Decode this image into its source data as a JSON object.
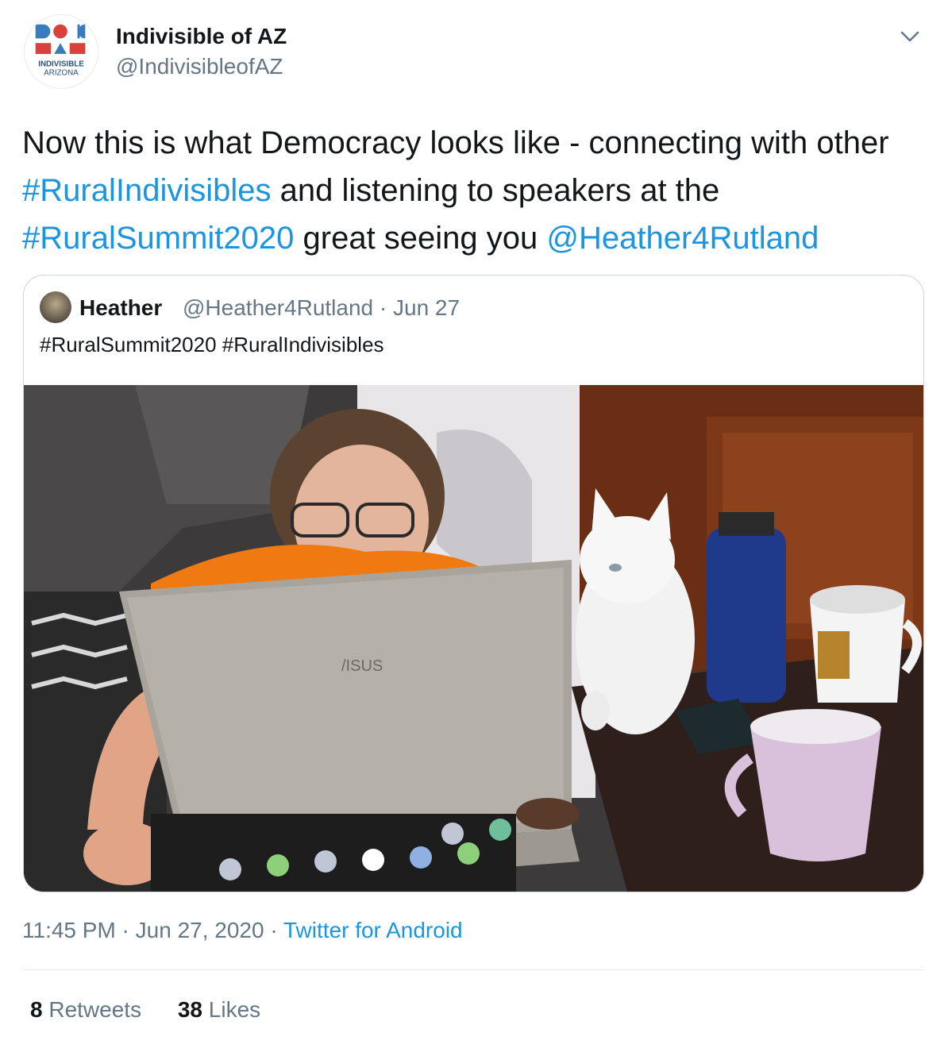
{
  "author": {
    "name": "Indivisible of AZ",
    "handle": "@IndivisibleofAZ",
    "avatar_lines": [
      "INDIVISIBLE",
      "ARIZONA"
    ],
    "avatar_icon": "indivisible-arizona-logo"
  },
  "menu": {
    "icon": "chevron-down-icon"
  },
  "tweet": {
    "segments": [
      {
        "text": "Now this is what Democracy looks like - connecting with other ",
        "link": false
      },
      {
        "text": "#RuralIndivisibles",
        "link": true
      },
      {
        "text": " and listening to speakers at the ",
        "link": false
      },
      {
        "text": "#RuralSummit2020",
        "link": true
      },
      {
        "text": " great seeing you ",
        "link": false
      },
      {
        "text": "@Heather4Rutland",
        "link": true
      }
    ]
  },
  "quoted": {
    "name": "Heather",
    "handle_date": "@Heather4Rutland · Jun 27",
    "text": "#RuralSummit2020 #RuralIndivisibles",
    "image_description_icon": "photo-woman-laptop-cat"
  },
  "meta": {
    "time_date": "11:45 PM · Jun 27, 2020 · ",
    "source": "Twitter for Android"
  },
  "stats": {
    "retweets_count": "8",
    "retweets_label": " Retweets",
    "likes_count": "38",
    "likes_label": " Likes"
  },
  "colors": {
    "link": "#1b95e0",
    "secondary_text": "#657786",
    "border": "#ccd6dd"
  }
}
